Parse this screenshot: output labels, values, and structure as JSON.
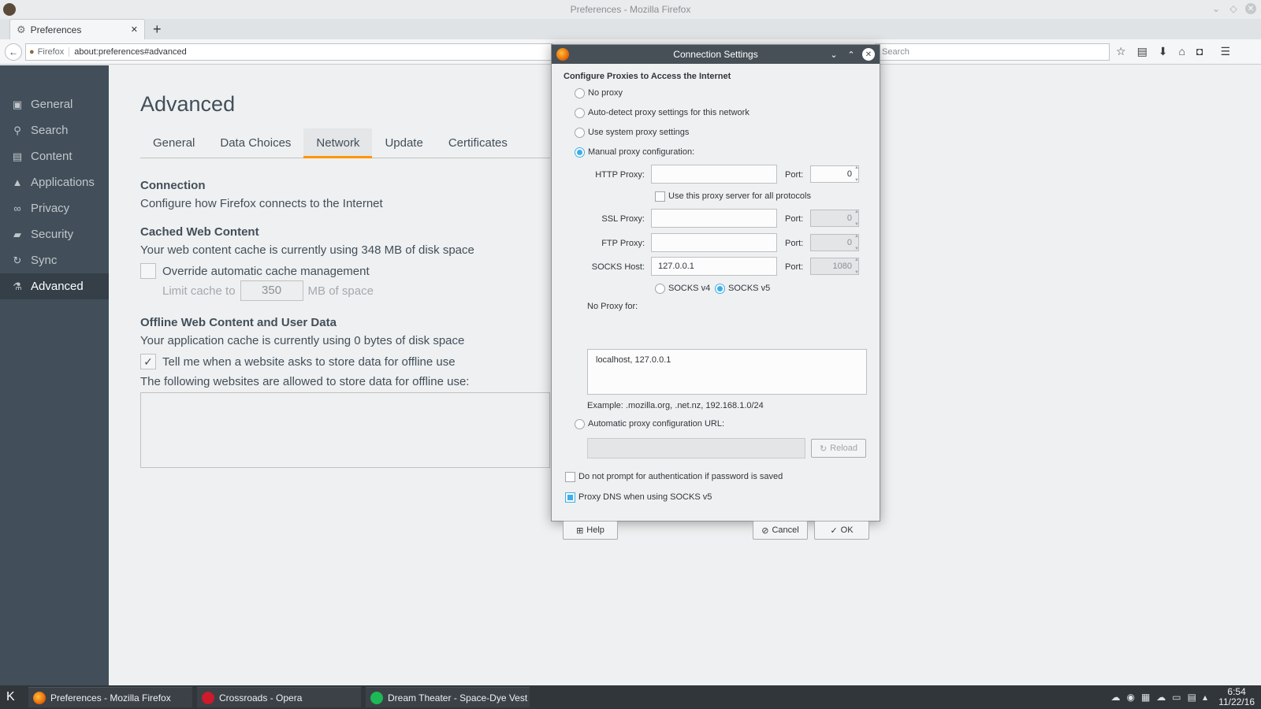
{
  "window": {
    "title": "Preferences - Mozilla Firefox"
  },
  "tab": {
    "label": "Preferences",
    "close": "✕",
    "new": "+"
  },
  "nav": {
    "identity": "Firefox",
    "url": "about:preferences#advanced",
    "search_placeholder": "Search"
  },
  "sidebar": {
    "items": [
      {
        "label": "General",
        "icon": "general-icon"
      },
      {
        "label": "Search",
        "icon": "search-icon"
      },
      {
        "label": "Content",
        "icon": "content-icon"
      },
      {
        "label": "Applications",
        "icon": "applications-icon"
      },
      {
        "label": "Privacy",
        "icon": "privacy-mask-icon"
      },
      {
        "label": "Security",
        "icon": "lock-icon"
      },
      {
        "label": "Sync",
        "icon": "sync-icon"
      },
      {
        "label": "Advanced",
        "icon": "advanced-icon"
      }
    ]
  },
  "page": {
    "title": "Advanced",
    "subtabs": [
      "General",
      "Data Choices",
      "Network",
      "Update",
      "Certificates"
    ],
    "connection_title": "Connection",
    "connection_text": "Configure how Firefox connects to the Internet",
    "cache_title": "Cached Web Content",
    "cache_text": "Your web content cache is currently using 348 MB of disk space",
    "cache_override": "Override automatic cache management",
    "cache_limit_prefix": "Limit cache to",
    "cache_limit_value": "350",
    "cache_limit_suffix": "MB of space",
    "offline_title": "Offline Web Content and User Data",
    "offline_text": "Your application cache is currently using 0 bytes of disk space",
    "offline_tell": "Tell me when a website asks to store data for offline use",
    "offline_allowed": "The following websites are allowed to store data for offline use:"
  },
  "dialog": {
    "title": "Connection Settings",
    "heading": "Configure Proxies to Access the Internet",
    "no_proxy": "No proxy",
    "auto_detect": "Auto-detect proxy settings for this network",
    "system": "Use system proxy settings",
    "manual": "Manual proxy configuration:",
    "http_label": "HTTP Proxy:",
    "port_label": "Port:",
    "http_port": "0",
    "all_protocols": "Use this proxy server for all protocols",
    "ssl_label": "SSL Proxy:",
    "ssl_port": "0",
    "ftp_label": "FTP Proxy:",
    "ftp_port": "0",
    "socks_label": "SOCKS Host:",
    "socks_host": "127.0.0.1",
    "socks_port": "1080",
    "socks_v4": "SOCKS v4",
    "socks_v5": "SOCKS v5",
    "no_proxy_for_label": "No Proxy for:",
    "no_proxy_for": "localhost, 127.0.0.1",
    "example": "Example: .mozilla.org, .net.nz, 192.168.1.0/24",
    "auto_url": "Automatic proxy configuration URL:",
    "reload": "Reload",
    "no_prompt": "Do not prompt for authentication if password is saved",
    "proxy_dns": "Proxy DNS when using SOCKS v5",
    "help": "Help",
    "cancel": "Cancel",
    "ok": "OK"
  },
  "taskbar": {
    "tasks": [
      "Preferences - Mozilla Firefox",
      "Crossroads - Opera",
      "Dream Theater - Space-Dye Vest"
    ],
    "time": "6:54",
    "date": "11/22/16"
  },
  "colors": {
    "accent": "#3daee9",
    "tab_underline": "#ff9500",
    "sidebar": "#424f5a"
  }
}
